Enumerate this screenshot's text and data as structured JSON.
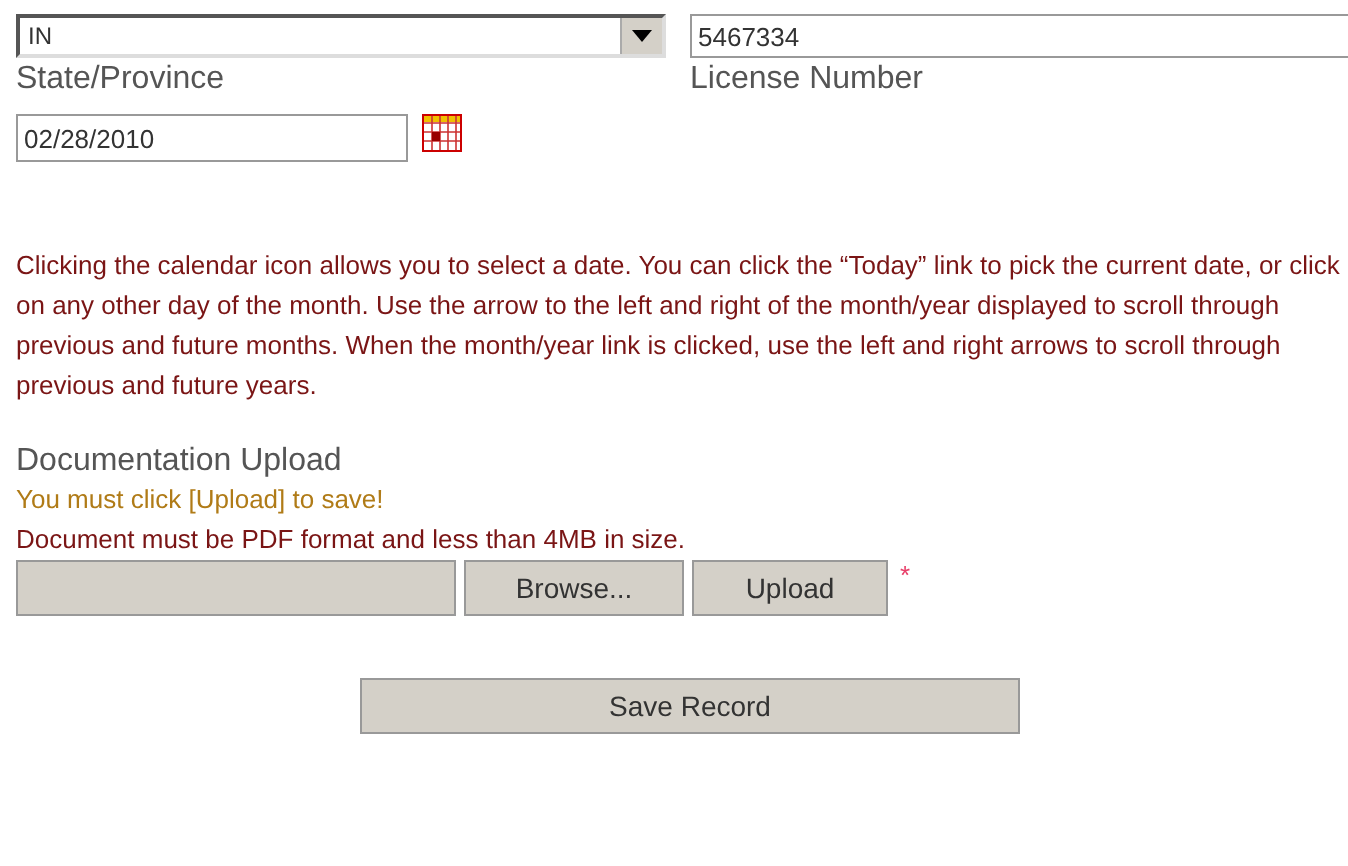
{
  "state_field": {
    "value": "IN",
    "label": "State/Province"
  },
  "license_field": {
    "value": "5467334",
    "label": "License Number"
  },
  "date_field": {
    "value": "02/28/2010"
  },
  "help_text": "Clicking the calendar icon allows you to select a date. You can click the “Today” link to pick the current date, or click on any other day of the month. Use the arrow to the left and right of the month/year displayed to scroll through previous and future months. When the month/year link is clicked, use the left and right arrows to scroll through previous and future years.",
  "upload": {
    "title": "Documentation Upload",
    "warning": "You must click [Upload] to save!",
    "note": "Document must be PDF format and less than 4MB in size.",
    "browse_button": "Browse...",
    "upload_button": "Upload",
    "required_mark": "*"
  },
  "save_button": "Save Record"
}
